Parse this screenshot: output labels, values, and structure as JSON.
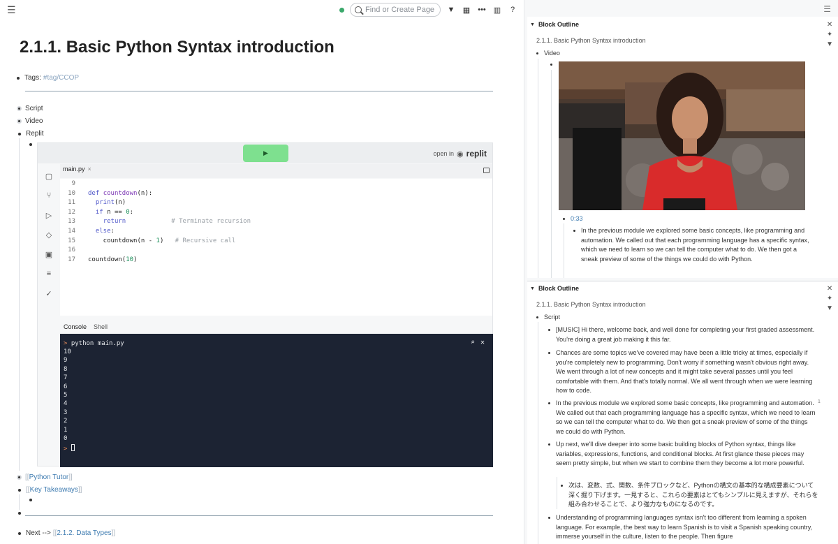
{
  "toolbar": {
    "search_placeholder": "Find or Create Page"
  },
  "page": {
    "title": "2.1.1. Basic Python Syntax introduction",
    "tags_label": "Tags:",
    "tag": "#tag/CCOP",
    "blocks": [
      "Script",
      "Video",
      "Replit"
    ],
    "python_tutor": "Python Tutor",
    "key_takeaways": "Key Takeaways",
    "next_label": "Next -->",
    "next_link": "2.1.2. Data Types",
    "bracket_open": "[[",
    "bracket_close": "]]"
  },
  "replit": {
    "open_in": "open in",
    "brand": "replit",
    "file_tab": "main.py",
    "code_lines": [
      {
        "n": "9",
        "t": ""
      },
      {
        "n": "10",
        "t": "def countdown(n):"
      },
      {
        "n": "11",
        "t": "  print(n)"
      },
      {
        "n": "12",
        "t": "  if n == 0:"
      },
      {
        "n": "13",
        "t": "    return            # Terminate recursion"
      },
      {
        "n": "14",
        "t": "  else:"
      },
      {
        "n": "15",
        "t": "    countdown(n - 1)   # Recursive call"
      },
      {
        "n": "16",
        "t": ""
      },
      {
        "n": "17",
        "t": "countdown(10)"
      }
    ],
    "console_tab": "Console",
    "shell_tab": "Shell",
    "command": "python main.py",
    "output": [
      "10",
      "9",
      "8",
      "7",
      "6",
      "5",
      "4",
      "3",
      "2",
      "1",
      "0"
    ]
  },
  "sidebar": {
    "outline1": {
      "header": "Block Outline",
      "title": "2.1.1. Basic Python Syntax introduction",
      "section": "Video",
      "timestamp": "0:33",
      "text": "In the previous module we explored some basic concepts, like programming and automation. We called out that each programming language has a specific syntax, which we need to learn so we can tell the computer what to do. We then got a sneak preview of some of the things we could do with Python."
    },
    "outline2": {
      "header": "Block Outline",
      "title": "2.1.1. Basic Python Syntax introduction",
      "section": "Script",
      "paras": [
        "[MUSIC] Hi there, welcome back, and well done for completing your first graded assessment. You're doing a great job making it this far.",
        "Chances are some topics we've covered may have been a little tricky at times, especially if you're completely new to programming. Don't worry if something wasn't obvious right away. We went through a lot of new concepts and it might take several passes until you feel comfortable with them. And that's totally normal. We all went through when we were learning how to code.",
        "In the previous module we explored some basic concepts, like programming and automation. We called out that each programming language has a specific syntax, which we need to learn so we can tell the computer what to do. We then got a sneak preview of some of the things we could do with Python.",
        "Up next, we'll dive deeper into some basic building blocks of Python syntax, things like variables, expressions, functions, and conditional blocks. At first glance these pieces may seem pretty simple, but when we start to combine them they become a lot more powerful.",
        "次は、変数、式、関数、条件ブロックなど、Pythonの構文の基本的な構成要素について深く掘り下げます。一見すると、これらの要素はとてもシンプルに見えますが、それらを組み合わせることで、より強力なものになるのです。",
        "Understanding of programming languages syntax isn't too different from learning a spoken language. For example, the best way to learn Spanish is to visit a Spanish speaking country, immerse yourself in the culture, listen to the people. Then figure"
      ],
      "side_number": "1"
    }
  },
  "colors": {
    "accent_link": "#3e7bb0",
    "run_button": "#7ee08f",
    "console_bg": "#1c2333"
  }
}
